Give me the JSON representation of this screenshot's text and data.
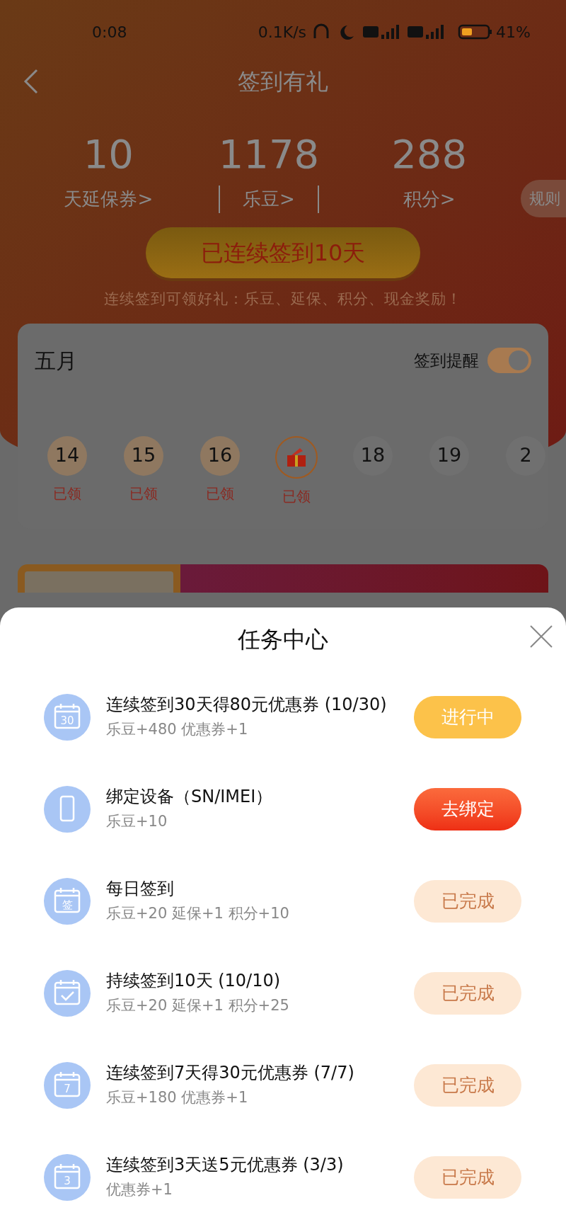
{
  "status_bar": {
    "time": "0:08",
    "speed": "0.1K/s",
    "battery": "41%"
  },
  "header": {
    "title": "签到有礼"
  },
  "stats": [
    {
      "value": "10",
      "label": "天延保券>"
    },
    {
      "value": "1178",
      "label": "乐豆>"
    },
    {
      "value": "288",
      "label": "积分>"
    }
  ],
  "rules_tab": "规则",
  "streak_button": "已连续签到10天",
  "subtitle": "连续签到可领好礼：乐豆、延保、积分、现金奖励！",
  "calendar": {
    "month": "五月",
    "reminder_label": "签到提醒",
    "reminder_on": true,
    "days": [
      {
        "kind": "day",
        "day": "14",
        "claimed": true,
        "status": "已领"
      },
      {
        "kind": "day",
        "day": "15",
        "claimed": true,
        "status": "已领"
      },
      {
        "kind": "day",
        "day": "16",
        "claimed": true,
        "status": "已领"
      },
      {
        "kind": "gift",
        "claimed": true,
        "status": "已领"
      },
      {
        "kind": "day",
        "day": "18",
        "claimed": false
      },
      {
        "kind": "day",
        "day": "19",
        "claimed": false
      },
      {
        "kind": "day",
        "day": "2",
        "claimed": false
      }
    ]
  },
  "task_center": {
    "title": "任务中心",
    "tasks": [
      {
        "icon": {
          "kind": "calendar",
          "text": "30"
        },
        "title": "连续签到30天得80元优惠券 (10/30)",
        "reward": "乐豆+480 优惠券+1",
        "action": {
          "kind": "in_progress",
          "label": "进行中"
        }
      },
      {
        "icon": {
          "kind": "phone"
        },
        "title": "绑定设备（SN/IMEI）",
        "reward": "乐豆+10",
        "action": {
          "kind": "bind",
          "label": "去绑定"
        }
      },
      {
        "icon": {
          "kind": "calendar",
          "text": "签"
        },
        "title": "每日签到",
        "reward": "乐豆+20 延保+1 积分+10",
        "action": {
          "kind": "done",
          "label": "已完成"
        }
      },
      {
        "icon": {
          "kind": "check"
        },
        "title": "持续签到10天 (10/10)",
        "reward": "乐豆+20 延保+1 积分+25",
        "action": {
          "kind": "done",
          "label": "已完成"
        }
      },
      {
        "icon": {
          "kind": "calendar",
          "text": "7"
        },
        "title": "连续签到7天得30元优惠券 (7/7)",
        "reward": "乐豆+180 优惠券+1",
        "action": {
          "kind": "done",
          "label": "已完成"
        }
      },
      {
        "icon": {
          "kind": "calendar",
          "text": "3"
        },
        "title": "连续签到3天送5元优惠券 (3/3)",
        "reward": "优惠券+1",
        "action": {
          "kind": "done",
          "label": "已完成"
        }
      }
    ]
  }
}
